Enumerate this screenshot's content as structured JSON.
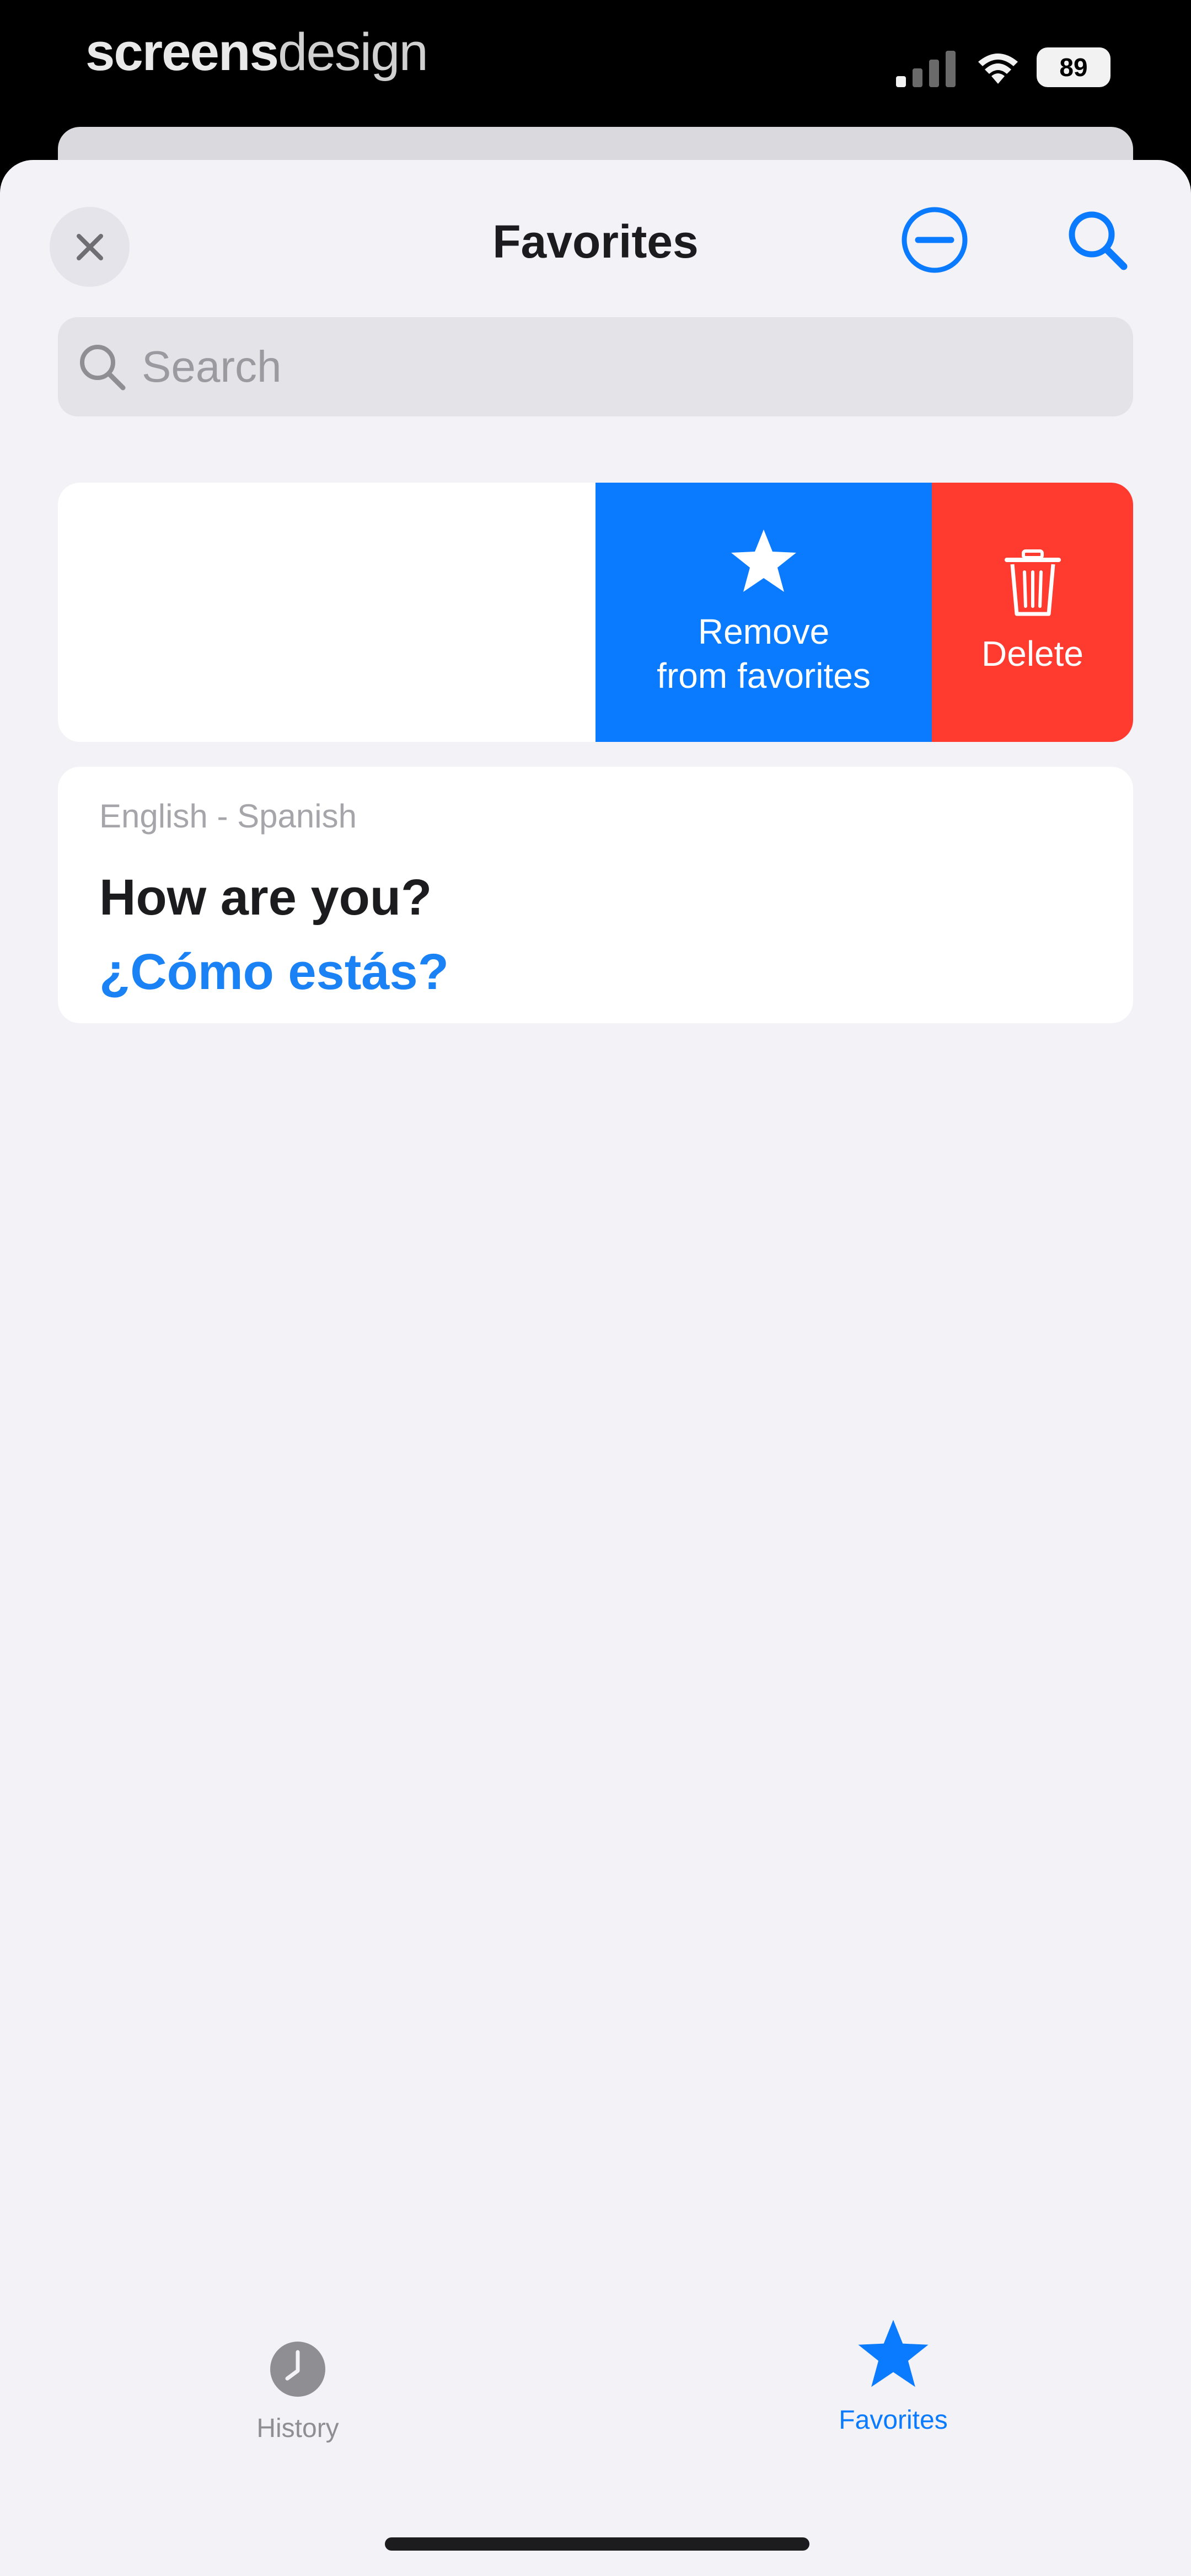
{
  "status_bar": {
    "watermark_bold": "screens",
    "watermark_light": "design",
    "battery": "89"
  },
  "header": {
    "title": "Favorites",
    "close_icon": "close-icon",
    "minus_icon": "minus-circle-icon",
    "search_icon": "search-icon"
  },
  "search": {
    "placeholder": "Search",
    "value": ""
  },
  "swipe_actions": {
    "favorite_label": "Remove\nfrom favorites",
    "favorite_icon": "star-icon",
    "favorite_color": "#0a7aff",
    "delete_label": "Delete",
    "delete_icon": "trash-icon",
    "delete_color": "#ff3b30"
  },
  "favorites": [
    {
      "languages": "English - Spanish",
      "source": "How are you?",
      "translation": "¿Cómo estás?"
    }
  ],
  "tab_bar": {
    "history_label": "History",
    "history_icon": "clock-icon",
    "favorites_label": "Favorites",
    "favorites_icon": "star-icon",
    "active_color": "#0a7aff",
    "inactive_color": "#8e8e93"
  }
}
